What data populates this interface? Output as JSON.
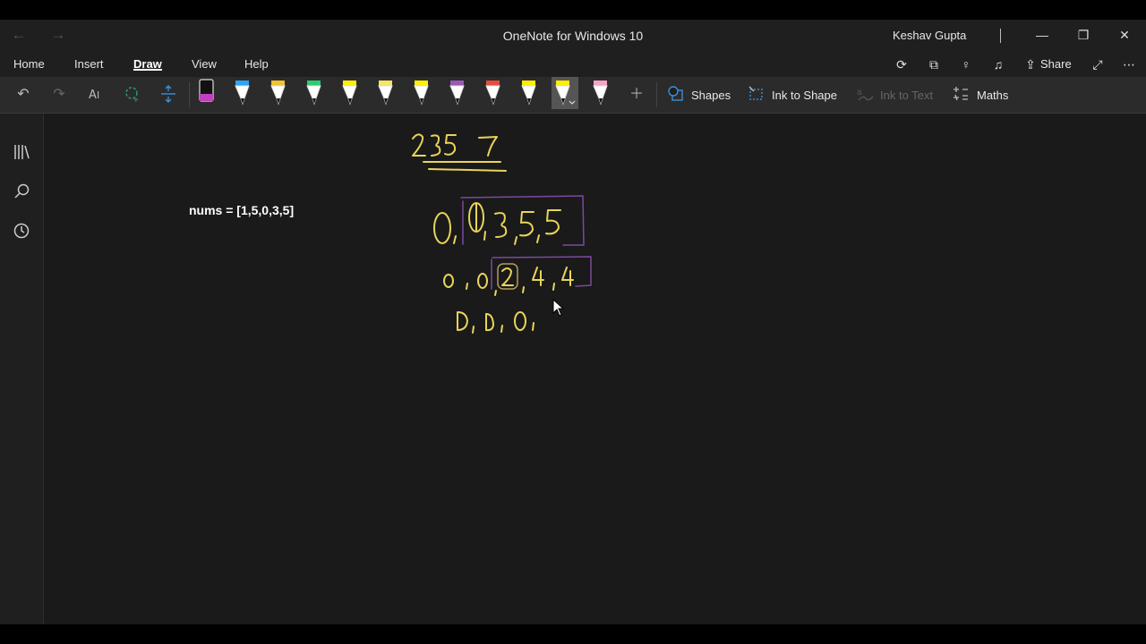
{
  "window": {
    "title": "OneNote for Windows 10",
    "user": "Keshav Gupta"
  },
  "menu": {
    "tabs": [
      "Home",
      "Insert",
      "Draw",
      "View",
      "Help"
    ],
    "active": "Draw",
    "share_label": "Share"
  },
  "ribbon": {
    "shapes_label": "Shapes",
    "ink_to_shape_label": "Ink to Shape",
    "ink_to_text_label": "Ink to Text",
    "maths_label": "Maths",
    "pen_colors": [
      "#c040c0",
      "#2ea3f2",
      "#f2c12e",
      "#2ecc71",
      "#ffee00",
      "#f5e663",
      "#fff000",
      "#9b59b6",
      "#e74c3c",
      "#ffee00",
      "#ffee00",
      "#f5a3c7"
    ]
  },
  "page": {
    "typed_text": "nums = [1,5,0,3,5]"
  },
  "colors": {
    "ink_yellow": "#e9d45a",
    "ink_purple": "#7b4a9e",
    "app_bg": "#1f1f1f"
  }
}
